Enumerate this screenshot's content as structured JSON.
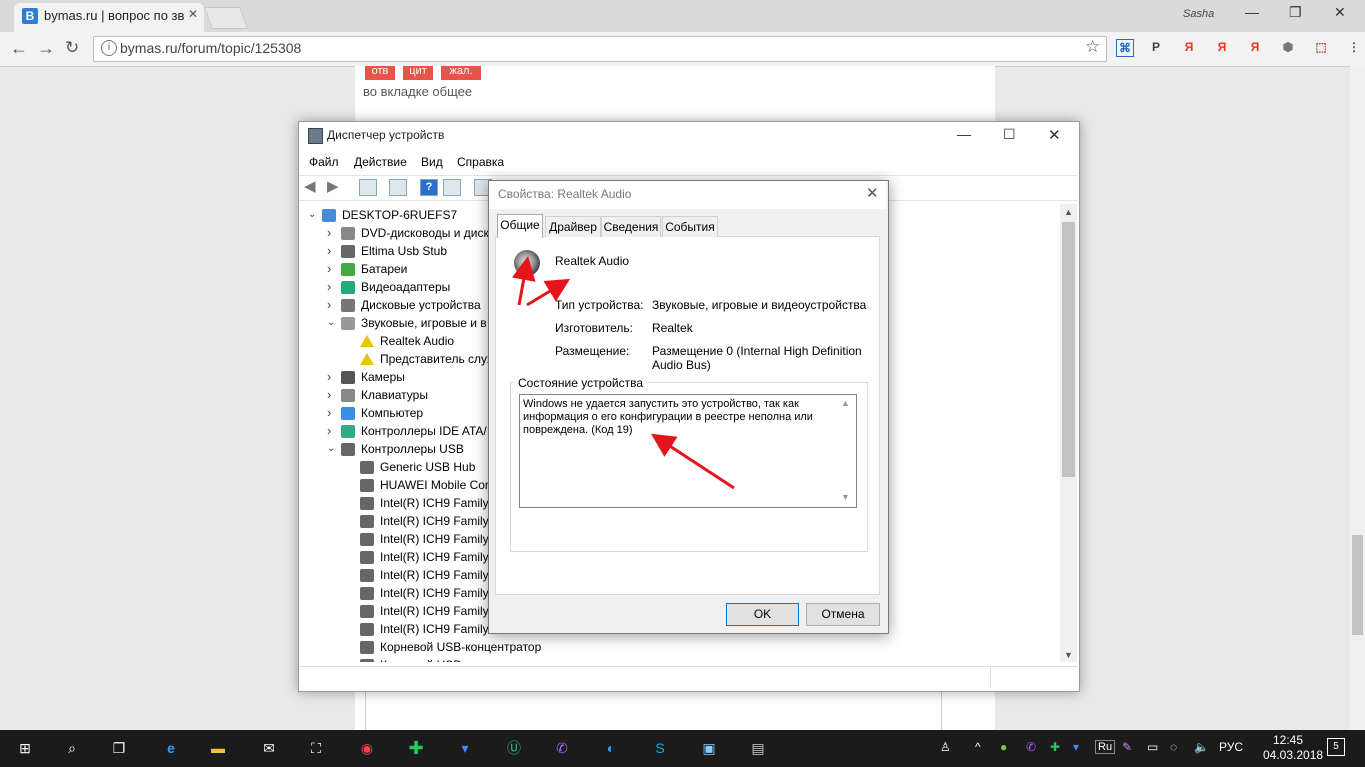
{
  "browser": {
    "tab_title": "bymas.ru | вопрос по зв",
    "tab_favicon": "В",
    "user": "Sasha",
    "url": "bymas.ru/forum/topic/125308",
    "extensions": [
      {
        "name": "profile-ext-icon",
        "glyph": "Р",
        "color": "#444"
      },
      {
        "name": "yandex-icon",
        "glyph": "Я",
        "color": "#e32"
      },
      {
        "name": "yandex-icon",
        "glyph": "Я",
        "color": "#e32"
      },
      {
        "name": "yandex-icon",
        "glyph": "Я",
        "color": "#e32"
      },
      {
        "name": "shield-ext-icon",
        "glyph": "⬢",
        "color": "#777"
      },
      {
        "name": "pdf-ext-icon",
        "glyph": "⬚",
        "color": "#c33"
      },
      {
        "name": "menu-icon",
        "glyph": "⋮",
        "color": "#555"
      }
    ]
  },
  "page": {
    "buttons": [
      "отв",
      "цит",
      "жал."
    ],
    "text_line": "во вкладке общее"
  },
  "devmgr": {
    "title": "Диспетчер устройств",
    "menu": [
      "Файл",
      "Действие",
      "Вид",
      "Справка"
    ],
    "tree": [
      {
        "level": 0,
        "exp": "down",
        "text": "DESKTOP-6RUEFS7",
        "icon": "computer-icon"
      },
      {
        "level": 1,
        "exp": "right",
        "text": "DVD-дисководы и диск",
        "icon": "dvd-icon"
      },
      {
        "level": 1,
        "exp": "right",
        "text": "Eltima Usb Stub",
        "icon": "usb-icon"
      },
      {
        "level": 1,
        "exp": "right",
        "text": "Батареи",
        "icon": "battery-icon"
      },
      {
        "level": 1,
        "exp": "right",
        "text": "Видеоадаптеры",
        "icon": "display-adapter-icon"
      },
      {
        "level": 1,
        "exp": "right",
        "text": "Дисковые устройства",
        "icon": "disk-icon"
      },
      {
        "level": 1,
        "exp": "down",
        "text": "Звуковые, игровые и в",
        "icon": "sound-icon"
      },
      {
        "level": 2,
        "exp": "",
        "text": "Realtek Audio",
        "icon": "warning-icon"
      },
      {
        "level": 2,
        "exp": "",
        "text": "Представитель служ",
        "icon": "warning-icon"
      },
      {
        "level": 1,
        "exp": "right",
        "text": "Камеры",
        "icon": "camera-icon"
      },
      {
        "level": 1,
        "exp": "right",
        "text": "Клавиатуры",
        "icon": "keyboard-icon"
      },
      {
        "level": 1,
        "exp": "right",
        "text": "Компьютер",
        "icon": "monitor-icon"
      },
      {
        "level": 1,
        "exp": "right",
        "text": "Контроллеры IDE ATA/",
        "icon": "ide-icon"
      },
      {
        "level": 1,
        "exp": "down",
        "text": "Контроллеры USB",
        "icon": "usb-icon"
      },
      {
        "level": 2,
        "exp": "",
        "text": "Generic USB Hub",
        "icon": "usb-icon"
      },
      {
        "level": 2,
        "exp": "",
        "text": "HUAWEI Mobile Con",
        "icon": "usb-icon"
      },
      {
        "level": 2,
        "exp": "",
        "text": "Intel(R) ICH9 Family",
        "icon": "usb-icon"
      },
      {
        "level": 2,
        "exp": "",
        "text": "Intel(R) ICH9 Family",
        "icon": "usb-icon"
      },
      {
        "level": 2,
        "exp": "",
        "text": "Intel(R) ICH9 Family",
        "icon": "usb-icon"
      },
      {
        "level": 2,
        "exp": "",
        "text": "Intel(R) ICH9 Family",
        "icon": "usb-icon"
      },
      {
        "level": 2,
        "exp": "",
        "text": "Intel(R) ICH9 Family",
        "icon": "usb-icon"
      },
      {
        "level": 2,
        "exp": "",
        "text": "Intel(R) ICH9 Family",
        "icon": "usb-icon"
      },
      {
        "level": 2,
        "exp": "",
        "text": "Intel(R) ICH9 Family",
        "icon": "usb-icon"
      },
      {
        "level": 2,
        "exp": "",
        "text": "Intel(R) ICH9 Family",
        "icon": "usb-icon"
      },
      {
        "level": 2,
        "exp": "",
        "text": "Корневой USB-концентратор",
        "icon": "usb-icon"
      },
      {
        "level": 2,
        "exp": "",
        "text": "Корневой USB-концентратор",
        "icon": "usb-icon"
      }
    ]
  },
  "dialog": {
    "title": "Свойства: Realtek Audio",
    "tabs": [
      "Общие",
      "Драйвер",
      "Сведения",
      "События"
    ],
    "device_name": "Realtek Audio",
    "fields": [
      {
        "label": "Тип устройства:",
        "value": "Звуковые, игровые и видеоустройства"
      },
      {
        "label": "Изготовитель:",
        "value": "Realtek"
      },
      {
        "label": "Размещение:",
        "value": "Размещение 0 (Internal High Definition Audio Bus)"
      }
    ],
    "status_group": "Состояние устройства",
    "status_text": "Windows не удается запустить это устройство, так как информация о его конфигурации в реестре неполна или повреждена. (Код 19)",
    "ok": "OK",
    "cancel": "Отмена"
  },
  "taskbar": {
    "lang": "РУС",
    "tray_lang_badge": "Ru",
    "time": "12:45",
    "date": "04.03.2018",
    "notif_count": "5"
  },
  "colors": {
    "annotation_arrow": "#e8141b",
    "accent": "#0078d7"
  }
}
